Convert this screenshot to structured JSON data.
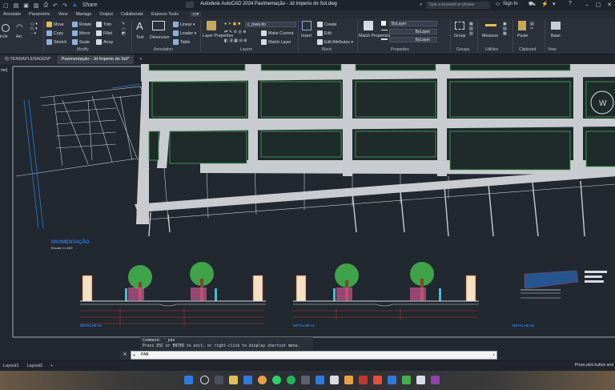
{
  "titlebar": {
    "app_title": "Autodesk AutoCAD 2024   Pavimentação - Jd Imperio do Sol.dwg",
    "share_label": "Share",
    "search_placeholder": "Type a keyword or phrase",
    "signin_label": "Sign In"
  },
  "ribbon_tabs": [
    "Annotate",
    "Parametric",
    "View",
    "Manage",
    "Output",
    "Collaborate",
    "Express Tools"
  ],
  "ribbon": {
    "draw": {
      "circle": "ircle",
      "arc": "Arc"
    },
    "modify": {
      "title": "Modify",
      "move": "Move",
      "rotate": "Rotate",
      "trim": "Trim",
      "copy": "Copy",
      "mirror": "Mirror",
      "fillet": "Fillet",
      "stretch": "Stretch",
      "scale": "Scale",
      "array": "Array"
    },
    "annotation": {
      "title": "Annotation",
      "text": "Text",
      "dimension": "Dimension",
      "linear": "Linear",
      "leader": "Leader",
      "table": "Table"
    },
    "layers": {
      "title": "Layers",
      "layer_properties": "Layer Properties",
      "current_layer": "c_meio-fio",
      "make_current": "Make Current",
      "match_layer": "Match Layer"
    },
    "block": {
      "title": "Block",
      "insert": "Insert",
      "create": "Create",
      "edit": "Edit",
      "edit_attributes": "Edit Attributes"
    },
    "properties": {
      "title": "Properties",
      "match_properties": "Match Properties",
      "color": "ByLayer",
      "linetype": "ByLayer",
      "lineweight": "ByLayer"
    },
    "groups": {
      "title": "Groups",
      "group": "Group"
    },
    "utilities": {
      "title": "Utilities",
      "measure": "Measure"
    },
    "clipboard": {
      "title": "Clipboard",
      "paste": "Paste"
    },
    "view": {
      "title": "View",
      "base": "Base"
    }
  },
  "file_tabs": [
    {
      "label": "0) TERRAPLENAGEM*",
      "active": false
    },
    {
      "label": "Pavimentação - Jd Imperio do Sol*",
      "active": true
    },
    {
      "label": "+",
      "active": false
    }
  ],
  "drawing": {
    "viewport_label": "me]",
    "plan_title": "PAVIMENTAÇÃO",
    "plan_scale": "Escala 1:1.000",
    "section_labels": [
      "DETALHE 01",
      "DETALHE 01",
      "DETALHE 02"
    ],
    "compass_letter": "W"
  },
  "command": {
    "history_line1": "Command: '_pan",
    "history_line2": "Press ESC or ENTER to exit, or right-click to display shortcut menu.",
    "current": "PAN"
  },
  "layout_tabs": [
    "Layout1",
    "Layout2",
    "+"
  ],
  "status_message": "Press pick button and",
  "colors": {
    "accent": "#2d7be0",
    "road": "#c8ccd1",
    "block_outline": "#3fb24a",
    "canvas": "#212830"
  }
}
